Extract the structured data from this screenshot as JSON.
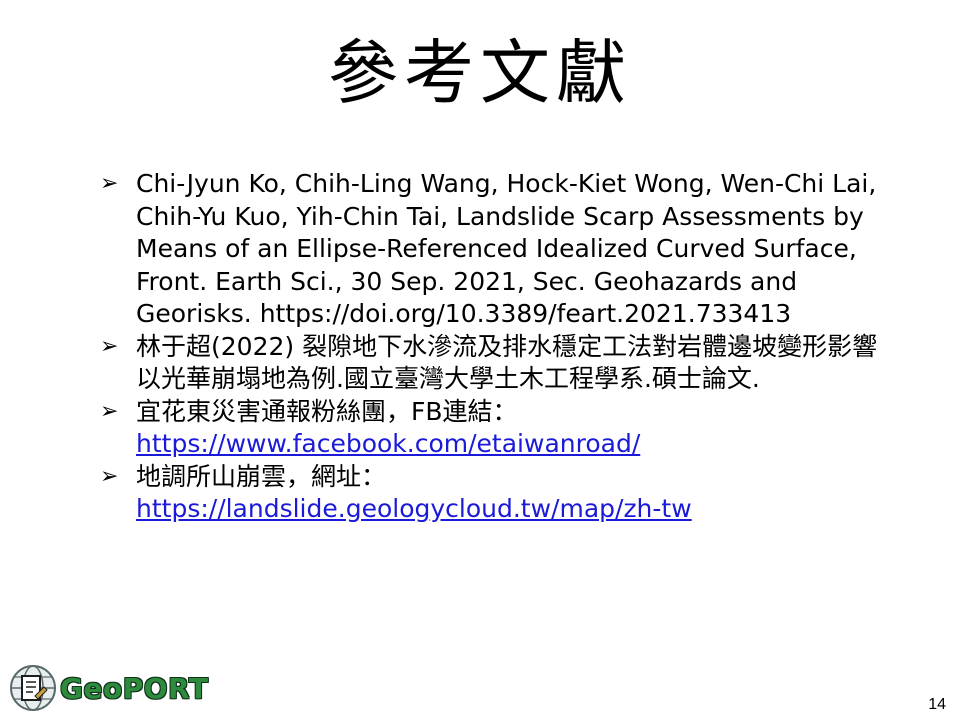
{
  "slide": {
    "title": "參考文獻",
    "bullet_glyph": "➢",
    "references": [
      {
        "text": "Chi-Jyun Ko, Chih-Ling Wang, Hock-Kiet Wong, Wen-Chi Lai, Chih-Yu Kuo, Yih-Chin Tai, Landslide Scarp Assessments by Means of an Ellipse-Referenced Idealized Curved Surface, Front. Earth Sci., 30 Sep. 2021, Sec. Geohazards and Georisks. https://doi.org/10.3389/feart.2021.733413"
      },
      {
        "text": "林于超(2022) 裂隙地下水滲流及排水穩定工法對岩體邊坡變形影響以光華崩塌地為例.國立臺灣大學土木工程學系.碩士論文."
      },
      {
        "text": "宜花東災害通報粉絲團，FB連結：",
        "link": "https://www.facebook.com/etaiwanroad/"
      },
      {
        "text": "地調所山崩雲，網址：",
        "link": "https://landslide.geologycloud.tw/map/zh-tw"
      }
    ],
    "logo_text": "GeoPORT",
    "page_number": "14"
  }
}
